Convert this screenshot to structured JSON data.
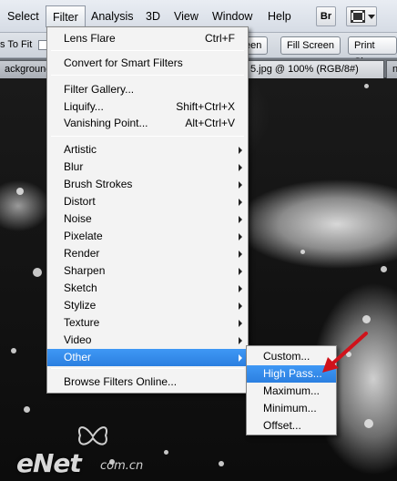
{
  "menubar": {
    "items": [
      "Select",
      "Filter",
      "Analysis",
      "3D",
      "View",
      "Window",
      "Help"
    ],
    "br_label": "Br",
    "icons": [
      "bridge-icon",
      "film-icon",
      "chevron-down-icon"
    ]
  },
  "options_bar": {
    "left_text": "s To Fit",
    "buttons": [
      "een",
      "Fill Screen",
      "Print Size"
    ]
  },
  "tabs": {
    "left": "ackground",
    "right": "5.jpg @ 100% (RGB/8#)",
    "far_right": "n"
  },
  "filter_menu": {
    "items": [
      {
        "label": "Lens Flare",
        "shortcut": "Ctrl+F"
      },
      {
        "label": "Convert for Smart Filters",
        "shortcut": ""
      },
      {
        "label": "Filter Gallery...",
        "shortcut": ""
      },
      {
        "label": "Liquify...",
        "shortcut": "Shift+Ctrl+X"
      },
      {
        "label": "Vanishing Point...",
        "shortcut": "Alt+Ctrl+V"
      },
      {
        "label": "Artistic",
        "submenu": true
      },
      {
        "label": "Blur",
        "submenu": true
      },
      {
        "label": "Brush Strokes",
        "submenu": true
      },
      {
        "label": "Distort",
        "submenu": true
      },
      {
        "label": "Noise",
        "submenu": true
      },
      {
        "label": "Pixelate",
        "submenu": true
      },
      {
        "label": "Render",
        "submenu": true
      },
      {
        "label": "Sharpen",
        "submenu": true
      },
      {
        "label": "Sketch",
        "submenu": true
      },
      {
        "label": "Stylize",
        "submenu": true
      },
      {
        "label": "Texture",
        "submenu": true
      },
      {
        "label": "Video",
        "submenu": true
      },
      {
        "label": "Other",
        "submenu": true,
        "highlighted": true
      },
      {
        "label": "Browse Filters Online...",
        "shortcut": ""
      }
    ]
  },
  "other_submenu": {
    "items": [
      {
        "label": "Custom..."
      },
      {
        "label": "High Pass...",
        "highlighted": true
      },
      {
        "label": "Maximum..."
      },
      {
        "label": "Minimum..."
      },
      {
        "label": "Offset..."
      }
    ]
  },
  "watermark": {
    "text": "eNet",
    "sub": "com.cn"
  },
  "colors": {
    "highlight": "#2b7fe0",
    "annotation_arrow": "#d0121b"
  }
}
